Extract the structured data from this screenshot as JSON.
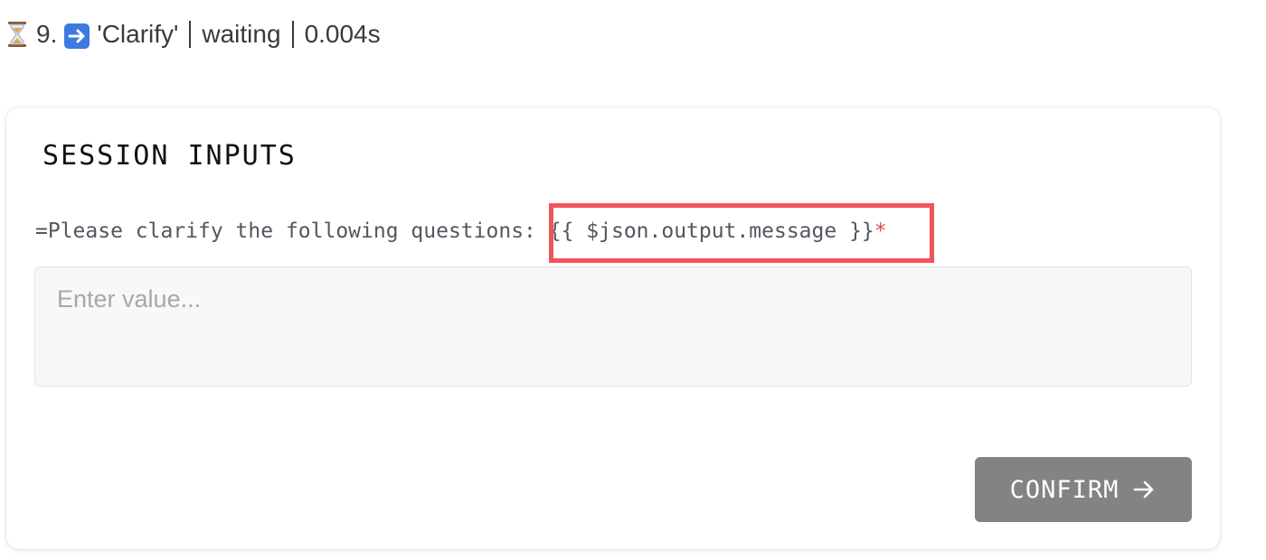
{
  "status": {
    "step_number": "9.",
    "step_name": "'Clarify'",
    "state": "waiting",
    "duration": "0.004s",
    "status_icon": "hourglass-icon",
    "step_icon": "right-arrow-icon"
  },
  "card": {
    "title": "SESSION INPUTS",
    "field": {
      "label_text": "=Please clarify the following questions: {{ $json.output.message }}",
      "required_marker": "*",
      "placeholder": "Enter value...",
      "value": ""
    },
    "confirm_label": "CONFIRM",
    "confirm_icon": "arrow-right-icon"
  },
  "colors": {
    "highlight": "#f2545b",
    "required": "#e5484d",
    "button_bg": "#838383",
    "step_icon_bg": "#3d7ae0"
  }
}
